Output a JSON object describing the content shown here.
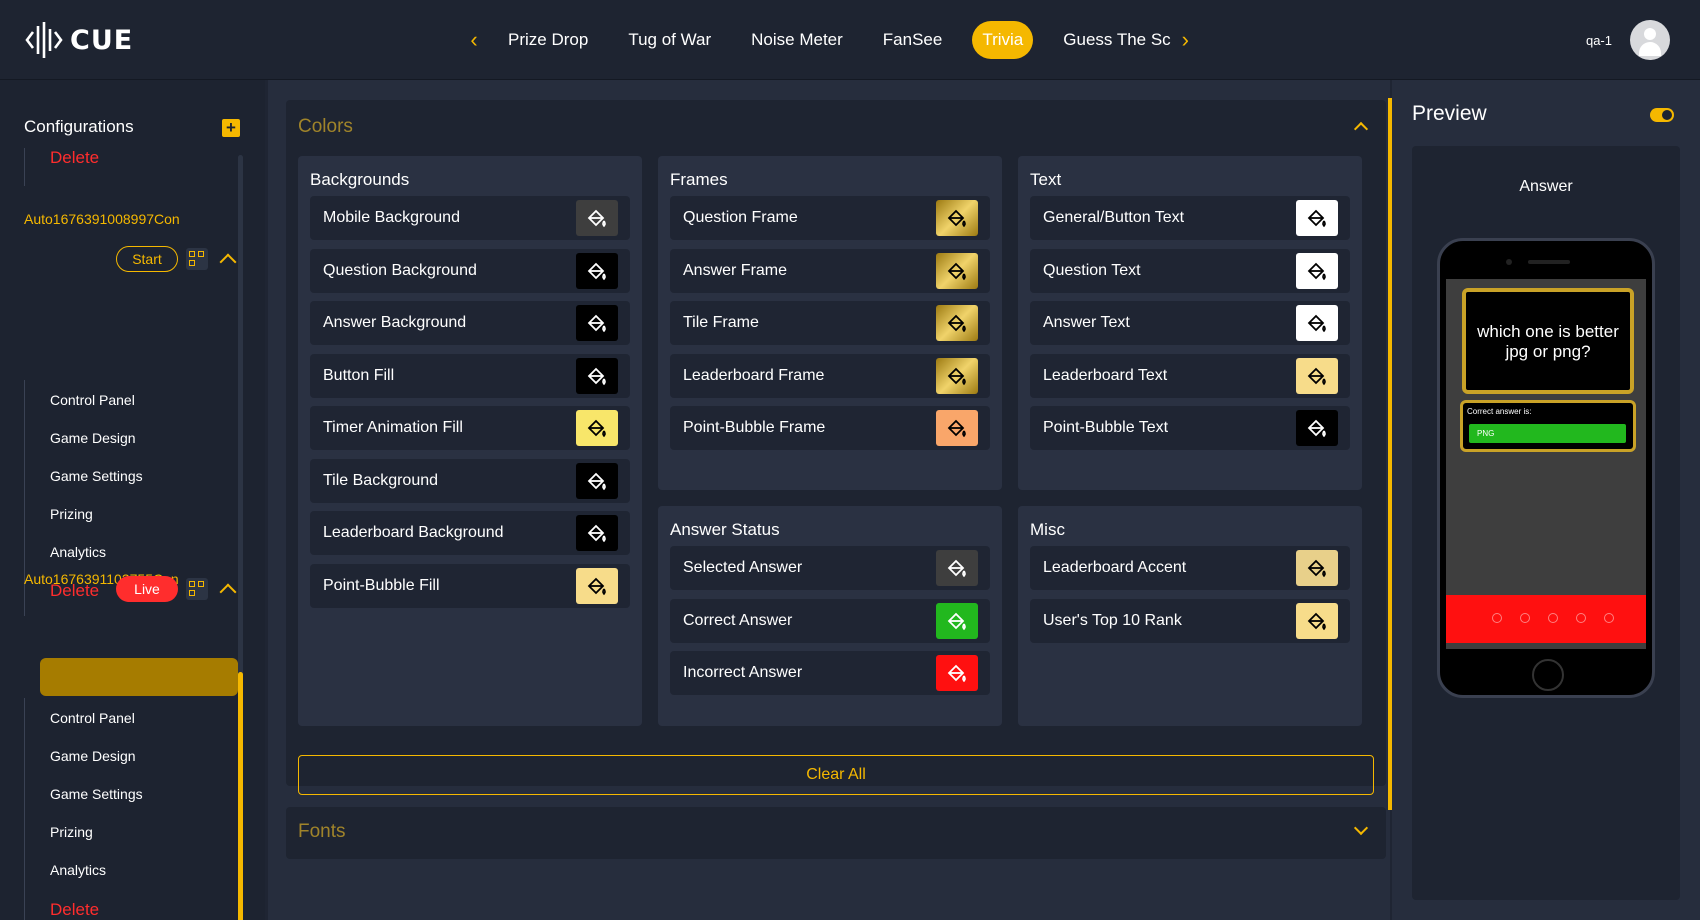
{
  "app": {
    "logo_text": "CUE"
  },
  "nav": {
    "tabs": [
      "Prize Drop",
      "Tug of War",
      "Noise Meter",
      "FanSee",
      "Trivia",
      "Guess The Sco"
    ],
    "active": "Trivia"
  },
  "user": {
    "name": "qa-1"
  },
  "sidebar": {
    "title": "Configurations",
    "top_delete": "Delete",
    "configs": [
      {
        "name": "Auto1676391008997Con",
        "status": "Start",
        "items": [
          "Control Panel",
          "Game Design",
          "Game Settings",
          "Prizing",
          "Analytics"
        ],
        "delete": "Delete"
      },
      {
        "name": "Auto1676391103755Con",
        "status": "Live",
        "items": [
          "Control Panel",
          "Game Design",
          "Game Settings",
          "Prizing",
          "Analytics"
        ],
        "delete": "Delete",
        "active_item": "Game Design"
      }
    ]
  },
  "colors": {
    "title": "Colors",
    "groups": {
      "backgrounds": {
        "title": "Backgrounds",
        "rows": [
          {
            "label": "Mobile Background",
            "color": "#3e3e3e"
          },
          {
            "label": "Question Background",
            "color": "#000000"
          },
          {
            "label": "Answer Background",
            "color": "#000000"
          },
          {
            "label": "Button Fill",
            "color": "#000000"
          },
          {
            "label": "Timer Animation Fill",
            "color": "#f8e66a"
          },
          {
            "label": "Tile Background",
            "color": "#000000"
          },
          {
            "label": "Leaderboard Background",
            "color": "#000000"
          },
          {
            "label": "Point-Bubble Fill",
            "color": "#f7dc8a"
          }
        ]
      },
      "frames": {
        "title": "Frames",
        "rows": [
          {
            "label": "Question Frame",
            "color": "#c9a227"
          },
          {
            "label": "Answer Frame",
            "color": "#c9a227"
          },
          {
            "label": "Tile Frame",
            "color": "#c9a227"
          },
          {
            "label": "Leaderboard Frame",
            "color": "#c9a227"
          },
          {
            "label": "Point-Bubble Frame",
            "color": "#f9a66a"
          }
        ]
      },
      "text": {
        "title": "Text",
        "rows": [
          {
            "label": "General/Button Text",
            "color": "#ffffff"
          },
          {
            "label": "Question Text",
            "color": "#ffffff"
          },
          {
            "label": "Answer Text",
            "color": "#ffffff"
          },
          {
            "label": "Leaderboard Text",
            "color": "#f7dc8a"
          },
          {
            "label": "Point-Bubble Text",
            "color": "#000000"
          }
        ]
      },
      "answer_status": {
        "title": "Answer Status",
        "rows": [
          {
            "label": "Selected Answer",
            "color": "#3e3e3e"
          },
          {
            "label": "Correct Answer",
            "color": "#22b81e"
          },
          {
            "label": "Incorrect Answer",
            "color": "#ff1010"
          }
        ]
      },
      "misc": {
        "title": "Misc",
        "rows": [
          {
            "label": "Leaderboard Accent",
            "color": "#e8d08a"
          },
          {
            "label": "User's Top 10 Rank",
            "color": "#f7dc8a"
          }
        ]
      }
    },
    "clear_all": "Clear All"
  },
  "fonts": {
    "title": "Fonts"
  },
  "preview": {
    "title": "Preview",
    "subtitle": "Answer",
    "question": "which one is better jpg or png?",
    "correct_label": "Correct answer is:",
    "correct_value": "PNG"
  }
}
